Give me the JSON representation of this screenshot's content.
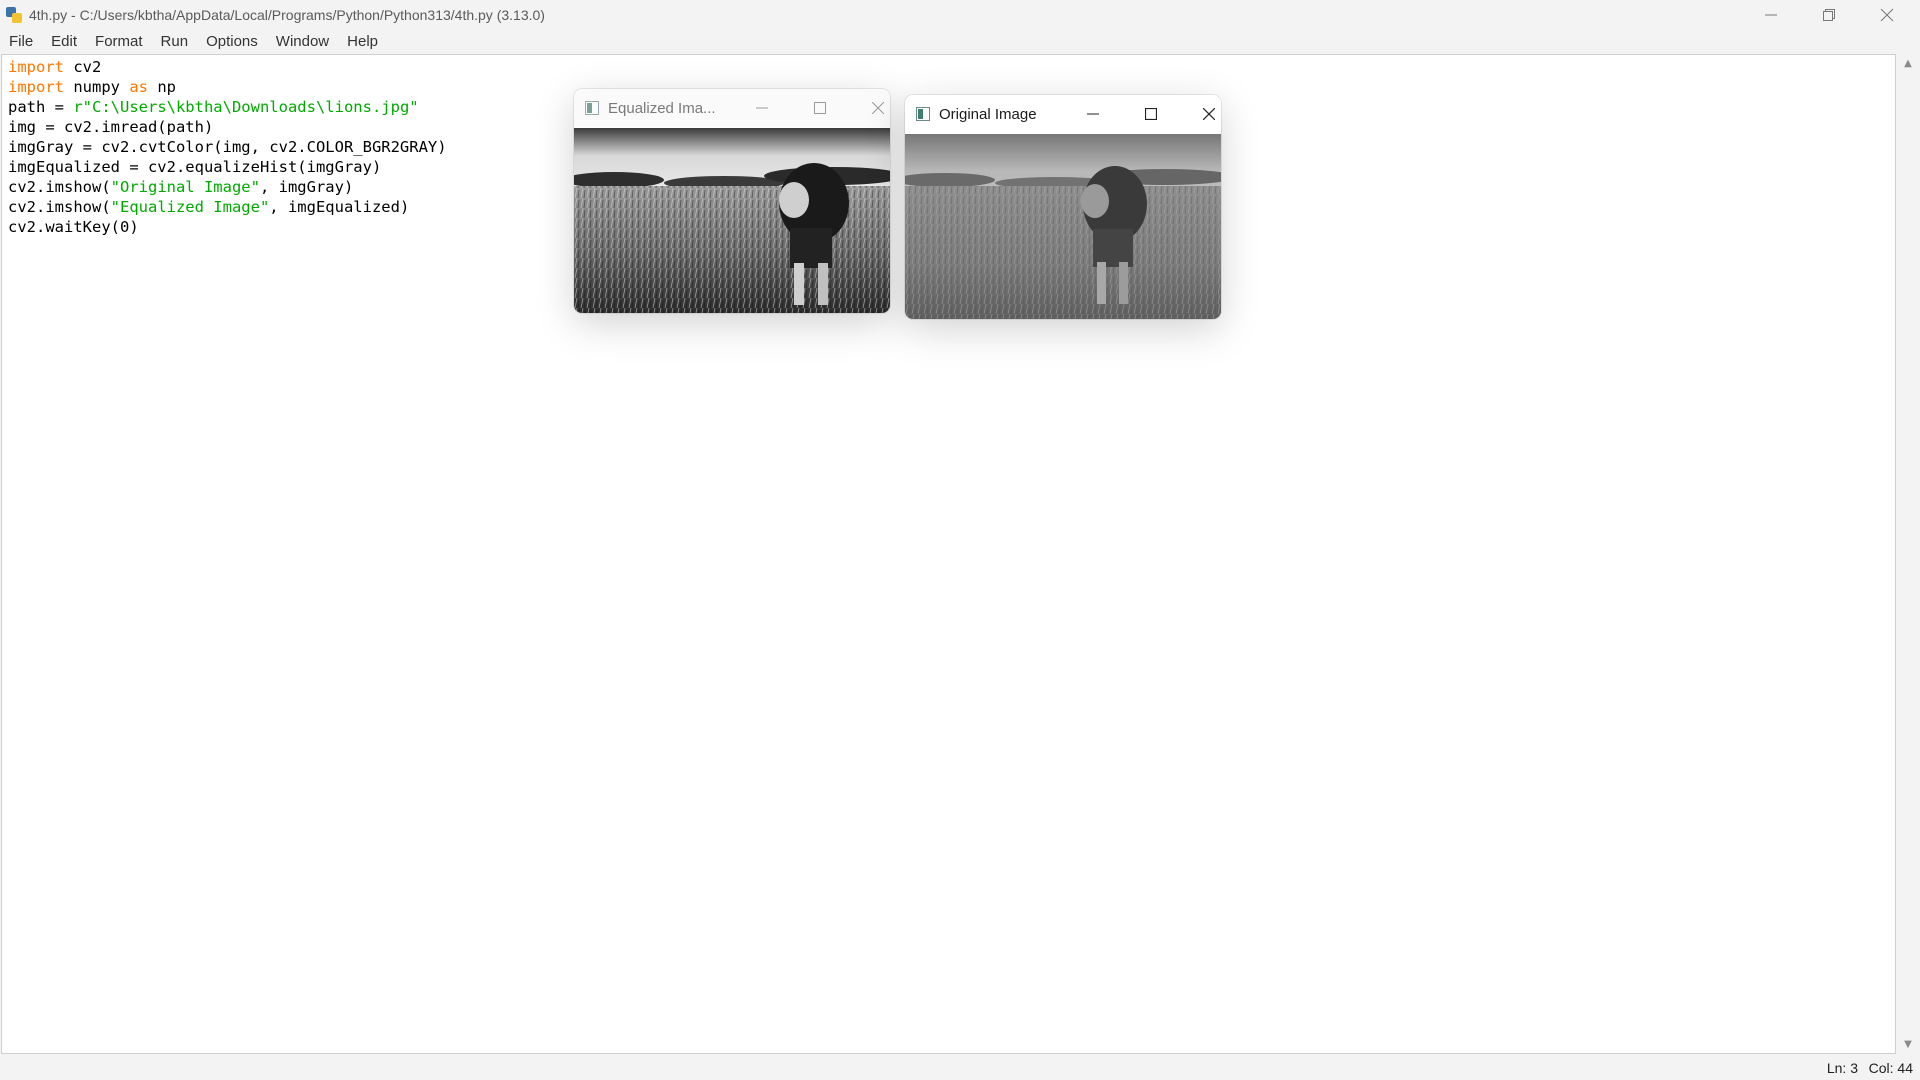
{
  "window": {
    "title": "4th.py - C:/Users/kbtha/AppData/Local/Programs/Python/Python313/4th.py (3.13.0)"
  },
  "menu": [
    "File",
    "Edit",
    "Format",
    "Run",
    "Options",
    "Window",
    "Help"
  ],
  "code_lines": [
    [
      {
        "t": "import",
        "c": "kw"
      },
      {
        "t": " cv2"
      }
    ],
    [
      {
        "t": "import",
        "c": "kw"
      },
      {
        "t": " numpy "
      },
      {
        "t": "as",
        "c": "kw"
      },
      {
        "t": " np"
      }
    ],
    [
      {
        "t": "path = "
      },
      {
        "t": "r\"C:\\Users\\kbtha\\Downloads\\lions.jpg\"",
        "c": "str"
      }
    ],
    [
      {
        "t": "img = cv2.imread(path)"
      }
    ],
    [
      {
        "t": "imgGray = cv2.cvtColor(img, cv2.COLOR_BGR2GRAY)"
      }
    ],
    [
      {
        "t": "imgEqualized = cv2.equalizeHist(imgGray)"
      }
    ],
    [
      {
        "t": "cv2.imshow("
      },
      {
        "t": "\"Original Image\"",
        "c": "str"
      },
      {
        "t": ", imgGray)"
      }
    ],
    [
      {
        "t": "cv2.imshow("
      },
      {
        "t": "\"Equalized Image\"",
        "c": "str"
      },
      {
        "t": ", imgEqualized)"
      }
    ],
    [
      {
        "t": "cv2.waitKey(0)"
      }
    ]
  ],
  "status": {
    "line": "Ln: 3",
    "col": "Col: 44"
  },
  "equalized_window": {
    "title": "Equalized Ima..."
  },
  "original_window": {
    "title": "Original Image"
  },
  "colors": {
    "keyword": "#ff7700",
    "string": "#00aa00",
    "chrome": "#f3f3f3"
  },
  "icons": [
    "python-idle-icon",
    "minimize-icon",
    "restore-icon",
    "close-icon",
    "opencv-window-icon",
    "maximize-icon",
    "scroll-up-icon",
    "scroll-down-icon"
  ]
}
